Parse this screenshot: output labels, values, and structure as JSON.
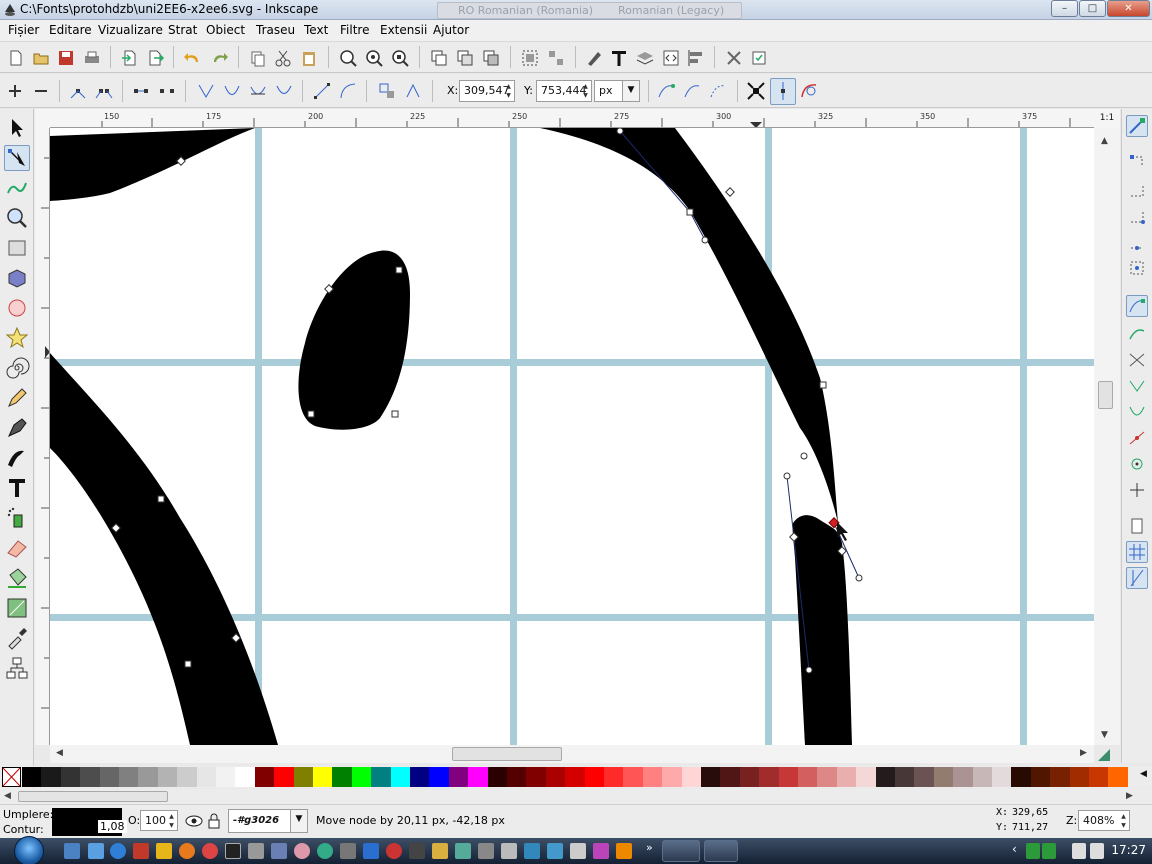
{
  "window": {
    "title": "C:\\Fonts\\protohdzb\\uni2EE6-x2ee6.svg - Inkscape",
    "lang_items": [
      "RO Romanian (Romania)",
      "Romanian (Legacy)"
    ],
    "buttons": {
      "minimize": "–",
      "maximize": "□",
      "close": "✕"
    }
  },
  "menu": [
    "Fișier",
    "Editare",
    "Vizualizare",
    "Strat",
    "Obiect",
    "Traseu",
    "Text",
    "Filtre",
    "Extensii",
    "Ajutor"
  ],
  "node_toolbar": {
    "x_label": "X:",
    "x_value": "309,547",
    "y_label": "Y:",
    "y_value": "753,444",
    "unit": "px"
  },
  "rulers": {
    "top": [
      "150",
      "175",
      "200",
      "225",
      "250",
      "275",
      "300",
      "325",
      "350",
      "375"
    ],
    "left": [
      "0",
      "5",
      "7",
      "5",
      "5",
      "0"
    ],
    "zoom_corner": "1:1"
  },
  "status": {
    "fill_label": "Umplere:",
    "stroke_label": "Contur:",
    "stroke_width": "1,08",
    "opacity_label": "O:",
    "opacity_value": "100",
    "layer": "-#g3026",
    "message": "Move node by 20,11 px, -42,18 px",
    "cursor_x_label": "X:",
    "cursor_x": "329,65",
    "cursor_y_label": "Y:",
    "cursor_y": "711,27",
    "zoom_label": "Z:",
    "zoom_value": "408%"
  },
  "palette_colors": [
    "#000000",
    "#1a1a1a",
    "#333333",
    "#4d4d4d",
    "#666666",
    "#808080",
    "#999999",
    "#b3b3b3",
    "#cccccc",
    "#e6e6e6",
    "#f2f2f2",
    "#ffffff",
    "#800000",
    "#ff0000",
    "#808000",
    "#ffff00",
    "#008000",
    "#00ff00",
    "#008080",
    "#00ffff",
    "#000080",
    "#0000ff",
    "#800080",
    "#ff00ff",
    "#2b0000",
    "#550000",
    "#800000",
    "#aa0000",
    "#d40000",
    "#ff0000",
    "#ff2a2a",
    "#ff5555",
    "#ff8080",
    "#ffaaaa",
    "#ffd5d5",
    "#280b0b",
    "#501616",
    "#782121",
    "#a02c2c",
    "#c83737",
    "#d35f5f",
    "#de8787",
    "#e9afaf",
    "#f4d7d7",
    "#241c1c",
    "#483737",
    "#6c5353",
    "#917c6f",
    "#ac9393",
    "#c8b7b7",
    "#e3dbdb",
    "#280b00",
    "#501600",
    "#782100",
    "#a02c00",
    "#c83700",
    "#ff6600"
  ],
  "taskbar": {
    "clock": "17:27"
  }
}
